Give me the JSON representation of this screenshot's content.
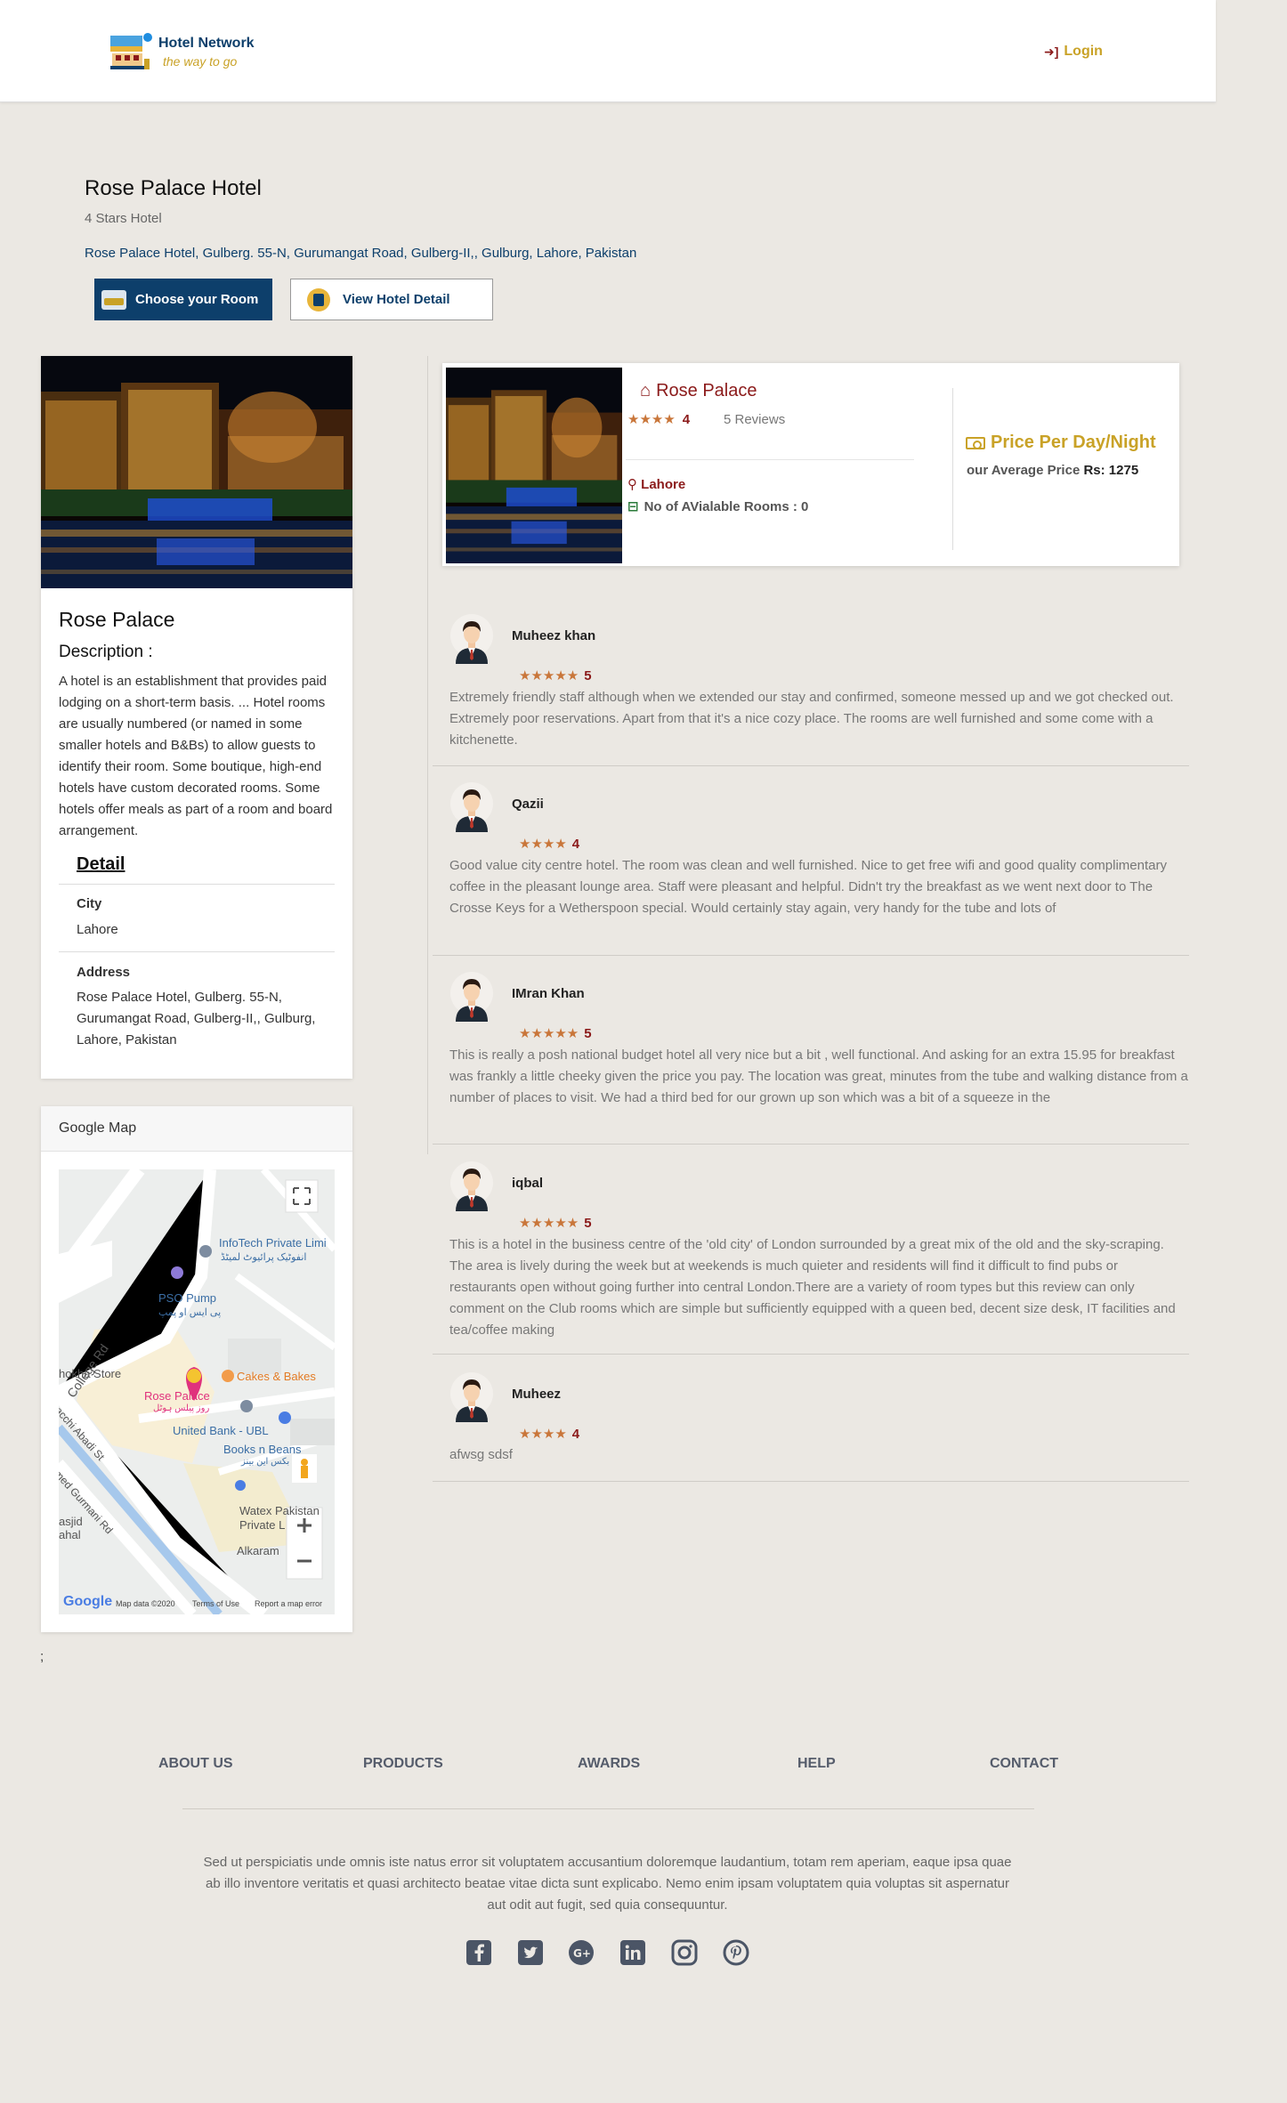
{
  "header": {
    "brand_name": "Hotel Network",
    "brand_tagline": "the way to go",
    "login_label": "Login"
  },
  "hotel": {
    "title": "Rose Palace Hotel",
    "stars_text": "4 Stars Hotel",
    "address": "Rose Palace Hotel, Gulberg. 55-N, Gurumangat Road, Gulberg-II,, Gulburg, Lahore, Pakistan",
    "choose_room_label": "Choose your Room",
    "view_detail_label": "View Hotel Detail"
  },
  "card": {
    "name": "Rose Palace",
    "description_heading": "Description :",
    "description": "A hotel is an establishment that provides paid lodging on a short-term basis. ... Hotel rooms are usually numbered (or named in some smaller hotels and B&Bs) to allow guests to identify their room. Some boutique, high-end hotels have custom decorated rooms. Some hotels offer meals as part of a room and board arrangement.",
    "detail_heading": "Detail",
    "city_label": "City",
    "city_value": "Lahore",
    "address_label": "Address",
    "address_value": "Rose Palace Hotel, Gulberg. 55-N, Gurumangat Road, Gulberg-II,, Gulburg, Lahore, Pakistan"
  },
  "map": {
    "heading": "Google Map",
    "labels": {
      "infotech": "InfoTech Private Limi",
      "infotech_ur": "انفوٹیک پرائیوٹ لمیٹڈ",
      "pso": "PSO Pump",
      "pso_ur": "پی ایس او پمپ",
      "college_rd": "College Rd",
      "khokha": "hokha Store",
      "cakes": "Cakes & Bakes",
      "rose_palace": "Rose Palace",
      "rose_palace_ur": "روز پیلس ہوٹل",
      "ubl": "United Bank - UBL",
      "books": "Books n Beans",
      "books_ur": "بکس این بینز",
      "abadi": "Pacchi Abadi St",
      "gurmani": "hmed Gurmani Rd",
      "masjid": "asjid",
      "masjid2": "ahal",
      "watex": "Watex Pakistan",
      "watex2": "Private L",
      "alkaram": "Alkaram",
      "google": "Google",
      "map_data": "Map data ©2020",
      "terms": "Terms of Use",
      "report": "Report a map error"
    }
  },
  "stray_text": ";",
  "summary": {
    "name": "Rose Palace",
    "rating": "4",
    "reviews": "5 Reviews",
    "city": "Lahore",
    "rooms": "No of AVialable Rooms : 0",
    "price_heading": "Price Per Day/Night",
    "price_label": "our Average Price",
    "price_value": "Rs: 1275"
  },
  "reviews": [
    {
      "name": "Muheez khan",
      "rating": "5",
      "stars": 5,
      "text": "Extremely friendly staff although when we extended our stay and confirmed, someone messed up and we got checked out. Extremely poor reservations. Apart from that it's a nice cozy place. The rooms are well furnished and some come with a kitchenette."
    },
    {
      "name": "Qazii",
      "rating": "4",
      "stars": 4,
      "text": "Good value city centre hotel. The room was clean and well furnished. Nice to get free wifi and good quality complimentary coffee in the pleasant lounge area. Staff were pleasant and helpful. Didn't try the breakfast as we went next door to The Crosse Keys for a Wetherspoon special. Would certainly stay again, very handy for the tube and lots of"
    },
    {
      "name": "IMran Khan",
      "rating": "5",
      "stars": 5,
      "text": "This is really a posh national budget hotel all very nice but a bit , well functional. And asking for an extra 15.95 for breakfast was frankly a little cheeky given the price you pay. The location was great, minutes from the tube and walking distance from a number of places to visit. We had a third bed for our grown up son which was a bit of a squeeze in the"
    },
    {
      "name": "iqbal",
      "rating": "5",
      "stars": 5,
      "text": "This is a hotel in the business centre of the 'old city' of London surrounded by a great mix of the old and the sky-scraping. The area is lively during the week but at weekends is much quieter and residents will find it difficult to find pubs or restaurants open without going further into central London.There are a variety of room types but this review can only comment on the Club rooms which are simple but sufficiently equipped with a queen bed, decent size desk, IT facilities and tea/coffee making"
    },
    {
      "name": "Muheez",
      "rating": "4",
      "stars": 4,
      "text": "afwsg sdsf"
    }
  ],
  "footer": {
    "nav": [
      "ABOUT US",
      "PRODUCTS",
      "AWARDS",
      "HELP",
      "CONTACT"
    ],
    "text": "Sed ut perspiciatis unde omnis iste natus error sit voluptatem accusantium doloremque laudantium, totam rem aperiam, eaque ipsa quae ab illo inventore veritatis et quasi architecto beatae vitae dicta sunt explicabo. Nemo enim ipsam voluptatem quia voluptas sit aspernatur aut odit aut fugit, sed quia consequuntur.",
    "social": [
      "facebook-icon",
      "twitter-icon",
      "google-plus-icon",
      "linkedin-icon",
      "instagram-icon",
      "pinterest-icon"
    ]
  },
  "colors": {
    "brand_blue": "#0d3f6b",
    "gold": "#c9a227",
    "maroon": "#8b1a1a",
    "star": "#c9763a",
    "background": "#ebe8e3"
  }
}
